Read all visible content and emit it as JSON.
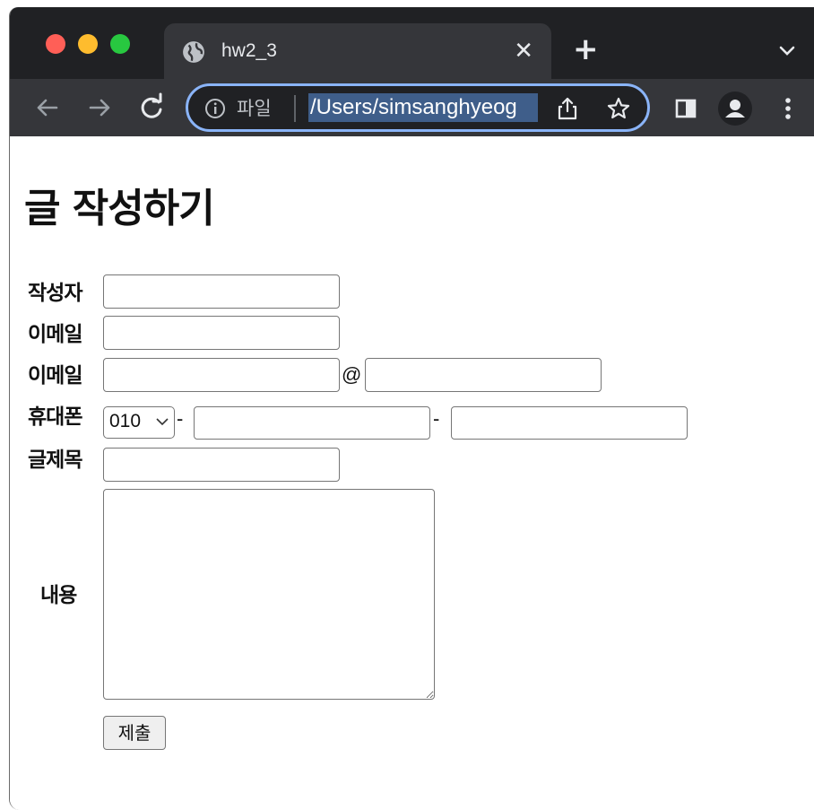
{
  "browser": {
    "tab_title": "hw2_3",
    "tab_close": "✕",
    "new_tab": "+",
    "address_scheme_label": "파일",
    "url": "/Users/simsanghyeog"
  },
  "page": {
    "heading": "글 작성하기",
    "form": {
      "author_label": "작성자",
      "email_label": "이메일",
      "email2_label": "이메일",
      "email_at": "@",
      "phone_label": "휴대폰",
      "phone_prefix": "010",
      "phone_dash1": "-",
      "phone_dash2": "-",
      "title_label": "글제목",
      "content_label": "내용",
      "submit_label": "제출"
    }
  }
}
